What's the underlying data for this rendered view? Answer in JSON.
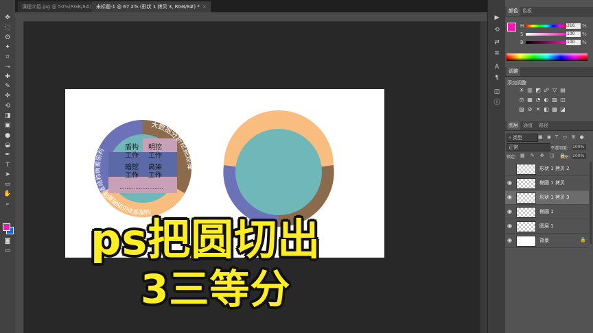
{
  "tabs": [
    {
      "label": "课程介绍.jpg @ 50%(RGB/8#)",
      "close": "×"
    },
    {
      "label": "未标题-1 @ 67.2% (形状 1 拷贝 3, RGB/8#) *",
      "close": "×"
    }
  ],
  "tools": [
    "move-tool",
    "marquee-tool",
    "lasso-tool",
    "magic-wand-tool",
    "crop-tool",
    "eyedropper-tool",
    "healing-brush-tool",
    "brush-tool",
    "clone-stamp-tool",
    "history-brush-tool",
    "eraser-tool",
    "gradient-tool",
    "blur-tool",
    "dodge-tool",
    "pen-tool",
    "type-tool",
    "path-selection-tool",
    "rectangle-tool",
    "hand-tool",
    "zoom-tool"
  ],
  "tool_glyphs": [
    "✥",
    "⬚",
    "ʘ",
    "✦",
    "⌗",
    "⊸",
    "✚",
    "✎",
    "✜",
    "⟲",
    "◨",
    "▣",
    "●",
    "◒",
    "✒",
    "T",
    "➤",
    "▭",
    "✋",
    "⌕"
  ],
  "colors": {
    "foreground": "#e91eb0",
    "background": "#1565e8",
    "canvas_bg": "#282828",
    "title_fill": "#ffee22"
  },
  "color_panel": {
    "tabs": [
      "颜色",
      "色板"
    ],
    "sliders": [
      {
        "label": "H",
        "value": "316"
      },
      {
        "label": "S",
        "value": "100"
      },
      {
        "label": "B",
        "value": "100"
      }
    ],
    "unit_pct": "%"
  },
  "adjustments_panel": {
    "tab": "调整",
    "title": "添加调整",
    "icons": [
      "☀",
      "▥",
      "◩",
      "☍",
      "▽",
      "▤",
      "⚖",
      "▦",
      "◔",
      "◐",
      "▧",
      "◫",
      "▨",
      "⊘",
      "✕",
      "◧",
      "▩",
      "◪"
    ]
  },
  "layers_panel": {
    "tabs": [
      "图层",
      "通道",
      "路径"
    ],
    "filter": "类型",
    "blend_mode": "正常",
    "opacity_label": "不透明度:",
    "opacity": "100%",
    "lock_label": "锁定:",
    "fill_label": "填充:",
    "fill": "100%",
    "layers": [
      {
        "name": "形状 1 拷贝 2",
        "visible": false,
        "selected": false
      },
      {
        "name": "椭圆 1 拷贝",
        "visible": true,
        "selected": false
      },
      {
        "name": "形状 1 拷贝 3",
        "visible": true,
        "selected": true
      },
      {
        "name": "椭圆 1",
        "visible": true,
        "selected": false
      },
      {
        "name": "图层 1",
        "visible": true,
        "selected": false
      },
      {
        "name": "背景",
        "visible": true,
        "selected": false
      }
    ]
  },
  "diagram_left": {
    "center_cells": [
      "盾构\n工作",
      "明挖\n工作",
      "暗挖\n工作",
      "高架\n工作"
    ],
    "ring_texts": [
      "隧道结构病害研判",
      "大数据分析挖掘规律",
      "基础知识体系架构"
    ],
    "dotted": "........................."
  },
  "donut_right": {
    "segments": [
      {
        "name": "top",
        "color": "#f9be7f",
        "value": "1/3"
      },
      {
        "name": "right",
        "color": "#8b6b4b",
        "value": "1/3"
      },
      {
        "name": "left",
        "color": "#6b72b8",
        "value": "1/3"
      }
    ],
    "center_color": "#6fb7b9"
  },
  "overlay": {
    "line1": "ps把圆切出",
    "line2": "3三等分"
  }
}
